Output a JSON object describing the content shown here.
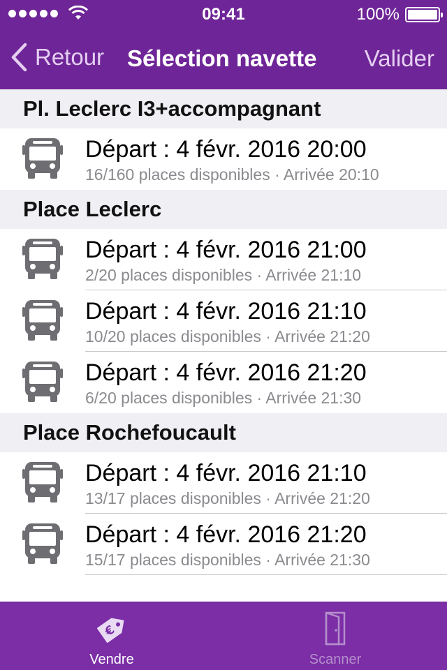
{
  "status_bar": {
    "time": "09:41",
    "battery": "100%"
  },
  "nav": {
    "back_label": "Retour",
    "title": "Sélection navette",
    "action_label": "Valider"
  },
  "sections": [
    {
      "title": "Pl. Leclerc I3+accompagnant",
      "rows": [
        {
          "main": "Départ : 4 févr. 2016 20:00",
          "sub": "16/160 places disponibles · Arrivée 20:10"
        }
      ]
    },
    {
      "title": "Place Leclerc",
      "rows": [
        {
          "main": "Départ : 4 févr. 2016 21:00",
          "sub": "2/20 places disponibles · Arrivée 21:10"
        },
        {
          "main": "Départ : 4 févr. 2016 21:10",
          "sub": "10/20 places disponibles · Arrivée 21:20"
        },
        {
          "main": "Départ : 4 févr. 2016 21:20",
          "sub": "6/20 places disponibles · Arrivée 21:30"
        }
      ]
    },
    {
      "title": "Place Rochefoucault",
      "rows": [
        {
          "main": "Départ : 4 févr. 2016 21:10",
          "sub": "13/17 places disponibles · Arrivée 21:20"
        },
        {
          "main": "Départ : 4 févr. 2016 21:20",
          "sub": "15/17 places disponibles · Arrivée 21:30"
        }
      ]
    }
  ],
  "tabs": [
    {
      "label": "Vendre",
      "icon": "price-tag-euro-icon",
      "active": true
    },
    {
      "label": "Scanner",
      "icon": "door-icon",
      "active": false
    }
  ],
  "colors": {
    "nav_background": "#6e2597",
    "tab_background": "#7b2ea6",
    "section_background": "#efeff4",
    "icon_gray": "#6d6d72"
  }
}
